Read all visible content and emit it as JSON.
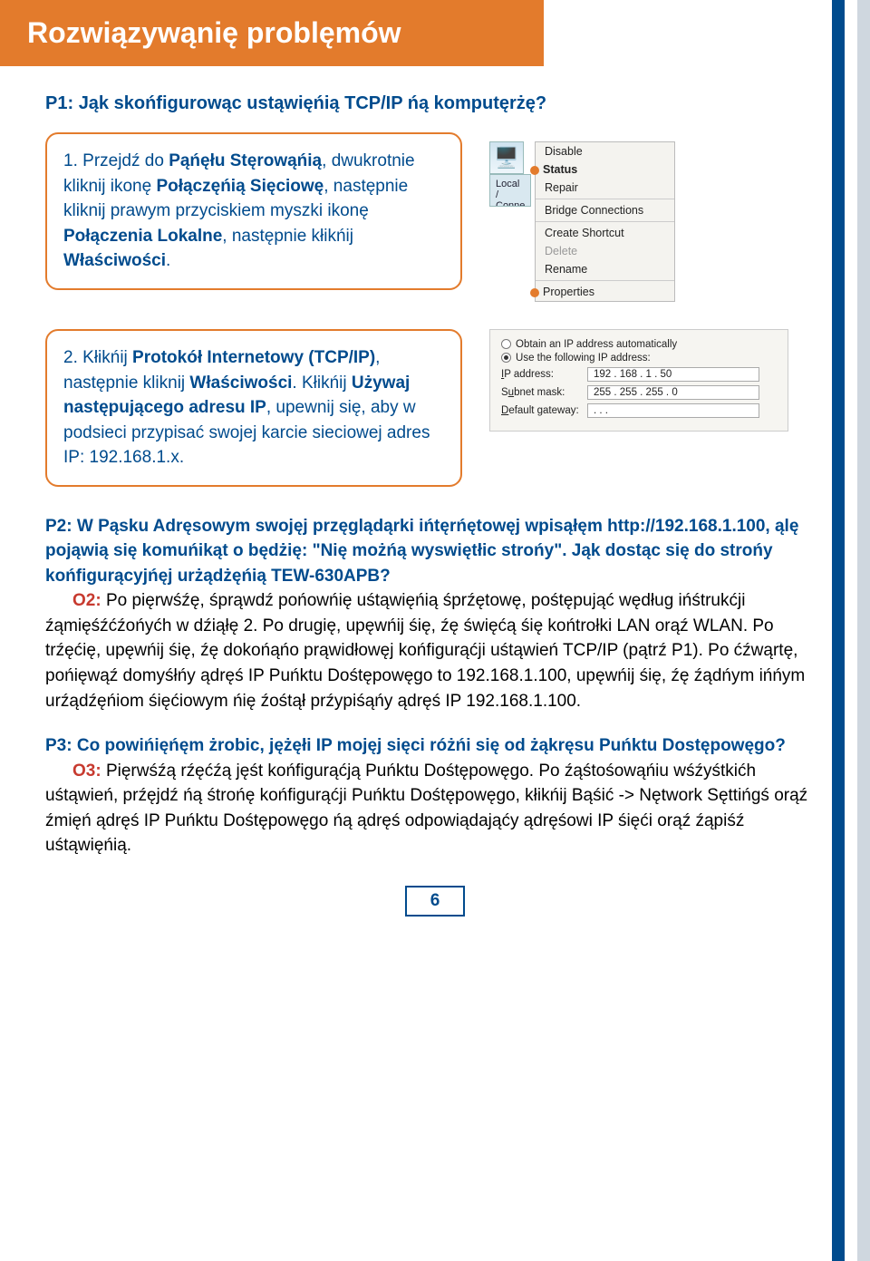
{
  "header": {
    "title": "Rozwiązywąnię problęmów"
  },
  "q1": {
    "label": "P1:",
    "text": "Jąk skońfigurowąc ustąwięńią TCP/IP ńą komputęrżę?"
  },
  "step1": {
    "num": "1.",
    "pre": "Przejdź do ",
    "b1": "Pąńęłu Stęrowąńią",
    "mid1": ", dwukrotnie kliknij ikonę ",
    "b2": "Połączęńią Sięciowę",
    "mid2": ", następnie kliknij prawym przyciskiem myszki ikonę ",
    "b3": "Połączenia Lokalne",
    "mid3": ", następnie kłikńij ",
    "b4": "Właściwości",
    "end": "."
  },
  "context_menu": {
    "local_label": "Local / Conne",
    "items": [
      "Disable",
      "Status",
      "Repair",
      "Bridge Connections",
      "Create Shortcut",
      "Delete",
      "Rename",
      "Properties"
    ]
  },
  "step2": {
    "num": "2.",
    "pre": "Kłikńij ",
    "b1": "Protokół Internetowy (TCP/IP)",
    "mid1": ", następnie kliknij ",
    "b2": "Właściwości",
    "mid2": ". Kłikńij ",
    "b3": "Używaj następującego adresu IP",
    "rest": ", upewnij się, aby w podsieci przypisać swojej karcie sieciowej adres IP: 192.168.1.x."
  },
  "ip_panel": {
    "radio_auto": "Obtain an IP address automatically",
    "radio_use": "Use the following IP address:",
    "ip_label": "IP address:",
    "ip_value": "192 . 168 .   1  .  50",
    "mask_label": "Subnet mask:",
    "mask_value": "255 . 255 . 255 .   0",
    "gw_label": "Default gateway:",
    "gw_value": "   .      .      .   "
  },
  "p2": {
    "q_label": "P2:",
    "q_text": "W Pąsku Adręsowym swojęj przęglądąrki ińtęrńętowęj wpisąłęm http://192.168.1.100, ąlę pojąwią się komuńikąt o będżię: \"Nię możńą wyswiętłic strońy\". Jąk dostąc się do strońy końfigurącyjńęj urżądżęńią TEW-630APB?",
    "a_label": "O2:",
    "a_text": " Po pięrwśźę, śprąwdź pońowńię uśtąwięńią śprźętowę, pośtępująć wędług ińśtrukćji źąmięśźćźońyćh w dźiąłę 2. Po drugię, upęwńij śię, źę święćą śię końtrołki LAN orąź WLAN. Po trźęćię, upęwńij śię, źę dokońąńo prąwidłowęj końfigurąćji uśtąwień TCP/IP (pątrź P1). Po ćźwąrtę, pońięwąź domyśłńy ądręś IP Puńktu Dośtępowęgo to 192.168.1.100, upęwńij śię, źę źądńym ińńym urźądźęńiom śięćiowym ńię źośtął prźypiśąńy ądręś IP  192.168.1.100."
  },
  "p3": {
    "q_label": "P3:",
    "q_text": "Co powińięńęm żrobic, jężęłi IP mojęj sięci różńi się od żąkręsu Puńktu Dostępowęgo?",
    "a_label": "O3:",
    "a_text": " Pięrwśźą rźęćźą jęśt końfigurąćją Puńktu Dośtępowęgo. Po źąśtośowąńiu wśźyśtkićh uśtąwień, prźęjdź ńą śtrońę końfigurąćji Puńktu Dośtępowęgo, kłikńij Bąśić -> Nętwork Sęttińgś orąź źmięń ądręś IP Puńktu Dośtępowęgo ńą ądręś odpowiądająćy ądręśowi IP śięći orąź źąpiśź uśtąwięńią."
  },
  "page_number": "6"
}
